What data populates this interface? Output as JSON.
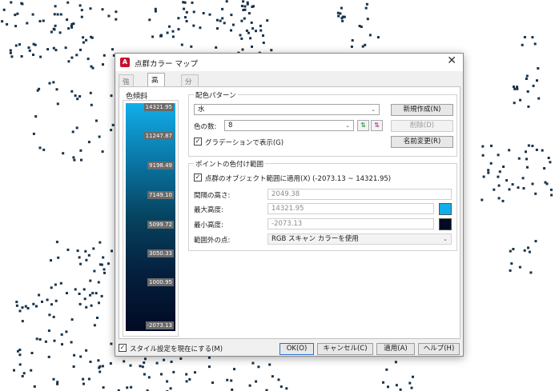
{
  "window": {
    "title": "点群カラー マップ",
    "app_icon_letter": "A"
  },
  "tabs": [
    {
      "label": "強度(I)",
      "active": false
    },
    {
      "label": "高度(E)",
      "active": true
    },
    {
      "label": "分類(F)",
      "active": false
    }
  ],
  "ramp": {
    "label": "色傾斜",
    "ticks": [
      "14321.95",
      "11247.87",
      "9198.49",
      "7149.10",
      "5099.72",
      "3050.33",
      "1000.95",
      "-2073.13"
    ]
  },
  "scheme": {
    "group_title": "配色パターン",
    "pattern_value": "水",
    "color_count_label": "色の数:",
    "color_count_value": "8",
    "gradient_label": "グラデーションで表示(G)",
    "gradient_checked": true,
    "new_button": "新規作成(N)",
    "delete_button": "削除(D)",
    "rename_button": "名前変更(R)"
  },
  "range": {
    "group_title": "ポイントの色付け範囲",
    "apply_label": "点群のオブジェクト範囲に適用(X)  (-2073.13 ~ 14321.95)",
    "apply_checked": true,
    "interval_label": "間隔の高さ:",
    "interval_value": "2049.38",
    "max_label": "最大高度:",
    "max_value": "14321.95",
    "max_color": "#12aeea",
    "min_label": "最小高度:",
    "min_value": "-2073.13",
    "min_color": "#020a24",
    "outside_label": "範囲外の点:",
    "outside_value": "RGB スキャン カラーを使用"
  },
  "footer": {
    "style_label": "スタイル設定を現在にする(M)",
    "style_checked": true,
    "ok": "OK(O)",
    "cancel": "キャンセル(C)",
    "apply": "適用(A)",
    "help": "ヘルプ(H)"
  },
  "colors": {
    "dot_color": "#16324a",
    "default_button_border": "#2a6dd0"
  }
}
